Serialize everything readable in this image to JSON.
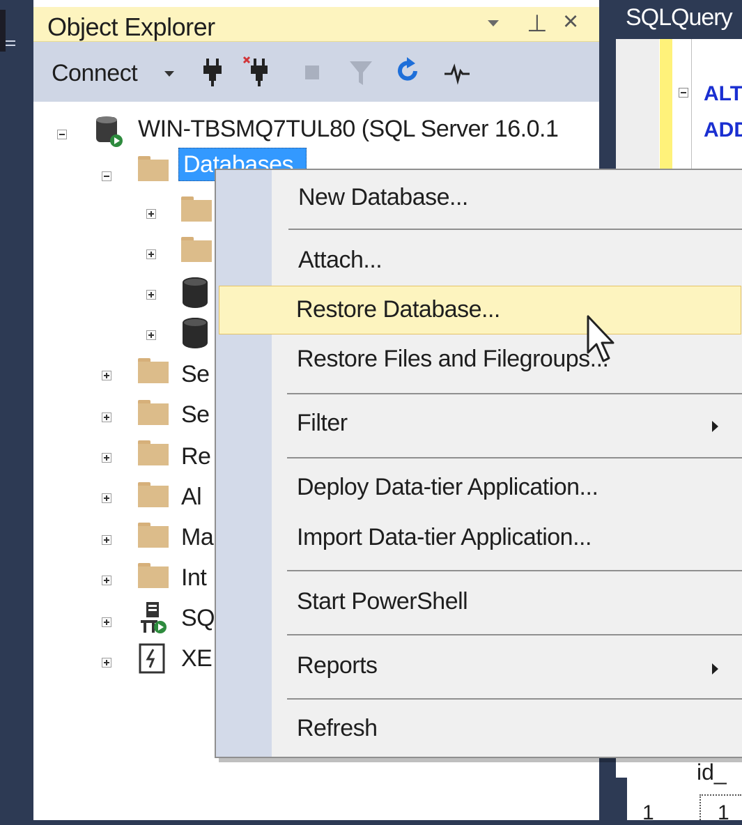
{
  "object_explorer": {
    "title": "Object Explorer",
    "toolbar": {
      "connect_label": "Connect",
      "icons": [
        "connect-plug-icon",
        "disconnect-plug-icon",
        "stop-icon",
        "filter-icon",
        "refresh-icon",
        "activity-monitor-icon"
      ]
    },
    "tree": {
      "server_node": "WIN-TBSMQ7TUL80 (SQL Server 16.0.1",
      "selected_node": "Databases",
      "child_nodes_truncated": [
        "Se",
        "Se",
        "Re",
        "Al",
        "Ma",
        "Int",
        "SQ",
        "XE"
      ]
    }
  },
  "editor": {
    "tab_title": "SQLQuery",
    "code_lines": [
      "ALT",
      "ADD"
    ],
    "results": {
      "column_header": "id_",
      "row_number": "1",
      "row_value": "1"
    }
  },
  "context_menu": {
    "items": [
      {
        "label": "New Database..."
      },
      {
        "label": "Attach..."
      },
      {
        "label": "Restore Database..."
      },
      {
        "label": "Restore Files and Filegroups..."
      },
      {
        "label": "Filter"
      },
      {
        "label": "Deploy Data-tier Application..."
      },
      {
        "label": "Import Data-tier Application..."
      },
      {
        "label": "Start PowerShell"
      },
      {
        "label": "Reports"
      },
      {
        "label": "Refresh"
      }
    ]
  },
  "colors": {
    "title_bar_active": "#fdf4bf",
    "toolbar_bg": "#cfd6e5",
    "selection_blue": "#3399ff",
    "ide_navy": "#2d3a54",
    "menu_highlight": "#fdf4bf",
    "menu_gutter": "#d3dae9"
  }
}
